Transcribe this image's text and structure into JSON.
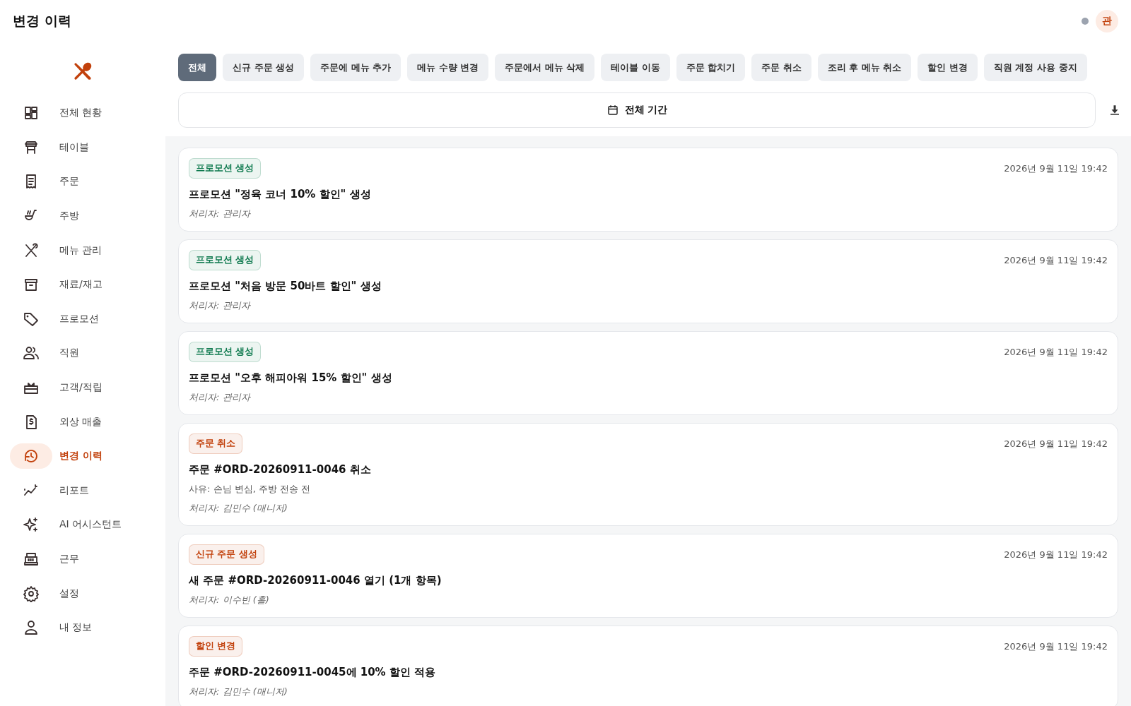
{
  "header": {
    "title": "변경 이력",
    "avatar": "관"
  },
  "sidebar": {
    "items": [
      {
        "label": "전체 현황",
        "selected": false
      },
      {
        "label": "테이블",
        "selected": false
      },
      {
        "label": "주문",
        "selected": false
      },
      {
        "label": "주방",
        "selected": false
      },
      {
        "label": "메뉴 관리",
        "selected": false
      },
      {
        "label": "재료/재고",
        "selected": false
      },
      {
        "label": "프로모션",
        "selected": false
      },
      {
        "label": "직원",
        "selected": false
      },
      {
        "label": "고객/적립",
        "selected": false
      },
      {
        "label": "외상 매출",
        "selected": false
      },
      {
        "label": "변경 이력",
        "selected": true
      },
      {
        "label": "리포트",
        "selected": false
      },
      {
        "label": "AI 어시스턴트",
        "selected": false
      },
      {
        "label": "근무",
        "selected": false
      },
      {
        "label": "설정",
        "selected": false
      },
      {
        "label": "내 정보",
        "selected": false
      }
    ]
  },
  "filters": [
    {
      "label": "전체",
      "selected": true
    },
    {
      "label": "신규 주문 생성",
      "selected": false
    },
    {
      "label": "주문에 메뉴 추가",
      "selected": false
    },
    {
      "label": "메뉴 수량 변경",
      "selected": false
    },
    {
      "label": "주문에서 메뉴 삭제",
      "selected": false
    },
    {
      "label": "테이블 이동",
      "selected": false
    },
    {
      "label": "주문 합치기",
      "selected": false
    },
    {
      "label": "주문 취소",
      "selected": false
    },
    {
      "label": "조리 후 메뉴 취소",
      "selected": false
    },
    {
      "label": "할인 변경",
      "selected": false
    },
    {
      "label": "직원 계정 사용 중지",
      "selected": false
    }
  ],
  "date_range": "전체 기간",
  "entries": [
    {
      "tag": "프로모션 생성",
      "color": "#0f7a4f",
      "time": "2026년 9월 11일 19:42",
      "title": "프로모션 \"정육 코너 10% 할인\" 생성",
      "handler": "처리자: 관리자"
    },
    {
      "tag": "프로모션 생성",
      "color": "#0f7a4f",
      "time": "2026년 9월 11일 19:42",
      "title": "프로모션 \"처음 방문 50바트 할인\" 생성",
      "handler": "처리자: 관리자"
    },
    {
      "tag": "프로모션 생성",
      "color": "#0f7a4f",
      "time": "2026년 9월 11일 19:42",
      "title": "프로모션 \"오후 해피아워 15% 할인\" 생성",
      "handler": "처리자: 관리자"
    },
    {
      "tag": "주문 취소",
      "color": "#c2410c",
      "time": "2026년 9월 11일 19:42",
      "title": "주문 #ORD-20260911-0046 취소",
      "reason": "사유: 손님 변심, 주방 전송 전",
      "handler": "처리자: 김민수 (매니저)"
    },
    {
      "tag": "신규 주문 생성",
      "color": "#c2410c",
      "time": "2026년 9월 11일 19:42",
      "title": "새 주문 #ORD-20260911-0046 열기 (1개 항목)",
      "handler": "처리자: 이수빈 (홀)"
    },
    {
      "tag": "할인 변경",
      "color": "#c2410c",
      "time": "2026년 9월 11일 19:42",
      "title": "주문 #ORD-20260911-0045에 10% 할인 적용",
      "handler": "처리자: 김민수 (매니저)"
    }
  ]
}
